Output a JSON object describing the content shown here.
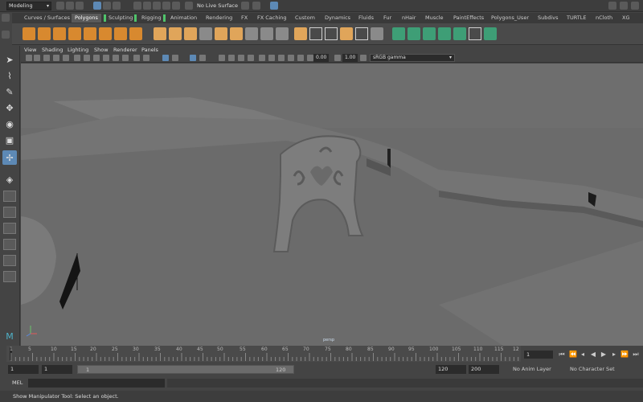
{
  "statusline": {
    "mode": "Modeling",
    "live_surface": "No Live Surface"
  },
  "shelf_tabs": [
    "Curves / Surfaces",
    "Polygons",
    "Sculpting",
    "Rigging",
    "Animation",
    "Rendering",
    "FX",
    "FX Caching",
    "Custom",
    "Dynamics",
    "Fluids",
    "Fur",
    "nHair",
    "Muscle",
    "PaintEffects",
    "Polygons_User",
    "Subdivs",
    "TURTLE",
    "nCloth",
    "XG"
  ],
  "active_tab": "Polygons",
  "panel_menu": [
    "View",
    "Shading",
    "Lighting",
    "Show",
    "Renderer",
    "Panels"
  ],
  "panel_tools": {
    "exposure": "0.00",
    "gamma": "1.00",
    "colorspace": "sRGB gamma"
  },
  "viewport": {
    "camera_label": "persp"
  },
  "timeline": {
    "ticks": [
      "1",
      "5",
      "10",
      "15",
      "20",
      "25",
      "30",
      "35",
      "40",
      "45",
      "50",
      "55",
      "60",
      "65",
      "70",
      "75",
      "80",
      "85",
      "90",
      "95",
      "100",
      "105",
      "110",
      "115",
      "12"
    ],
    "current_frame": "1"
  },
  "range": {
    "start_field": "1",
    "start_playback": "1",
    "slider_start": "1",
    "slider_end": "120",
    "end_playback": "120",
    "end_field": "200",
    "anim_layer": "No Anim Layer",
    "character_set": "No Character Set"
  },
  "mel": {
    "label": "MEL"
  },
  "helpline": {
    "text": "Show Manipulator Tool: Select an object."
  },
  "colors": {
    "accent": "#5d89b5",
    "polygon_icon": "#d8892f",
    "green_tab_marker": "#4fc46a"
  }
}
